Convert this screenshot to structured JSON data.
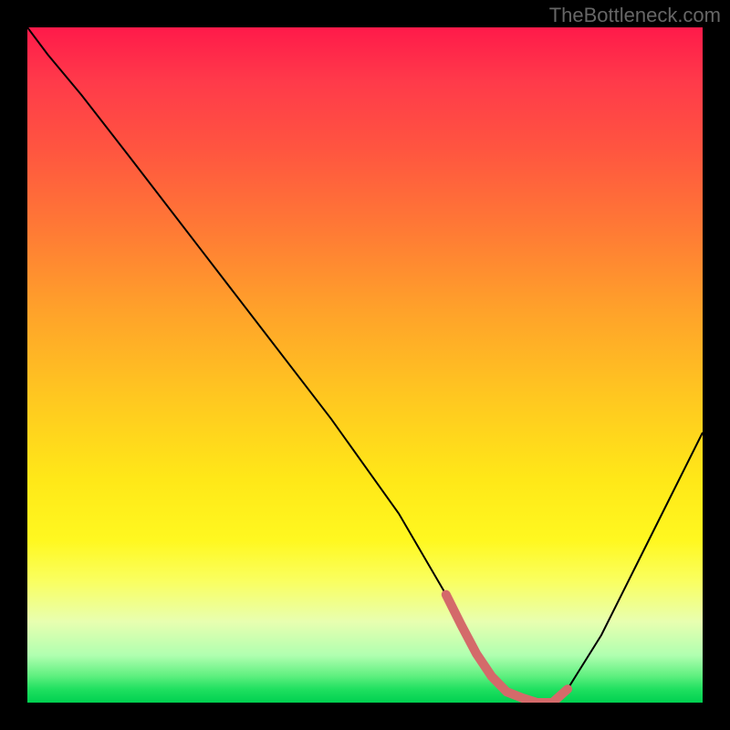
{
  "watermark": "TheBottleneck.com",
  "chart_data": {
    "type": "line",
    "title": "",
    "xlabel": "",
    "ylabel": "",
    "xlim": [
      0,
      100
    ],
    "ylim": [
      0,
      100
    ],
    "x": [
      0,
      3,
      8,
      15,
      25,
      35,
      45,
      55,
      62,
      66,
      70,
      75,
      78,
      80,
      85,
      90,
      95,
      100
    ],
    "values": [
      100,
      96,
      90,
      81,
      68,
      55,
      42,
      28,
      16,
      8,
      2,
      0,
      0,
      2,
      10,
      20,
      30,
      40
    ],
    "highlight_range_x": [
      62,
      80
    ],
    "highlight_color": "#d46a6a",
    "curve_color": "#000000"
  }
}
